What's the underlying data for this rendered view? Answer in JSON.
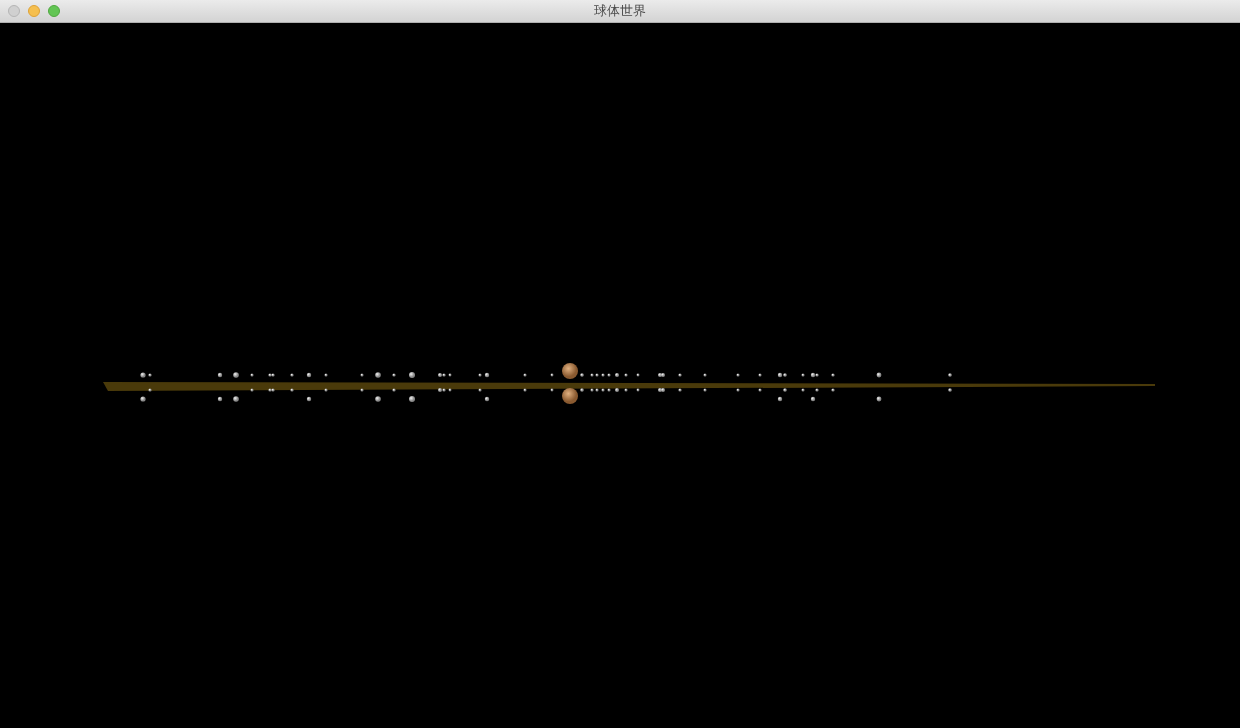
{
  "window": {
    "title": "球体世界"
  }
}
